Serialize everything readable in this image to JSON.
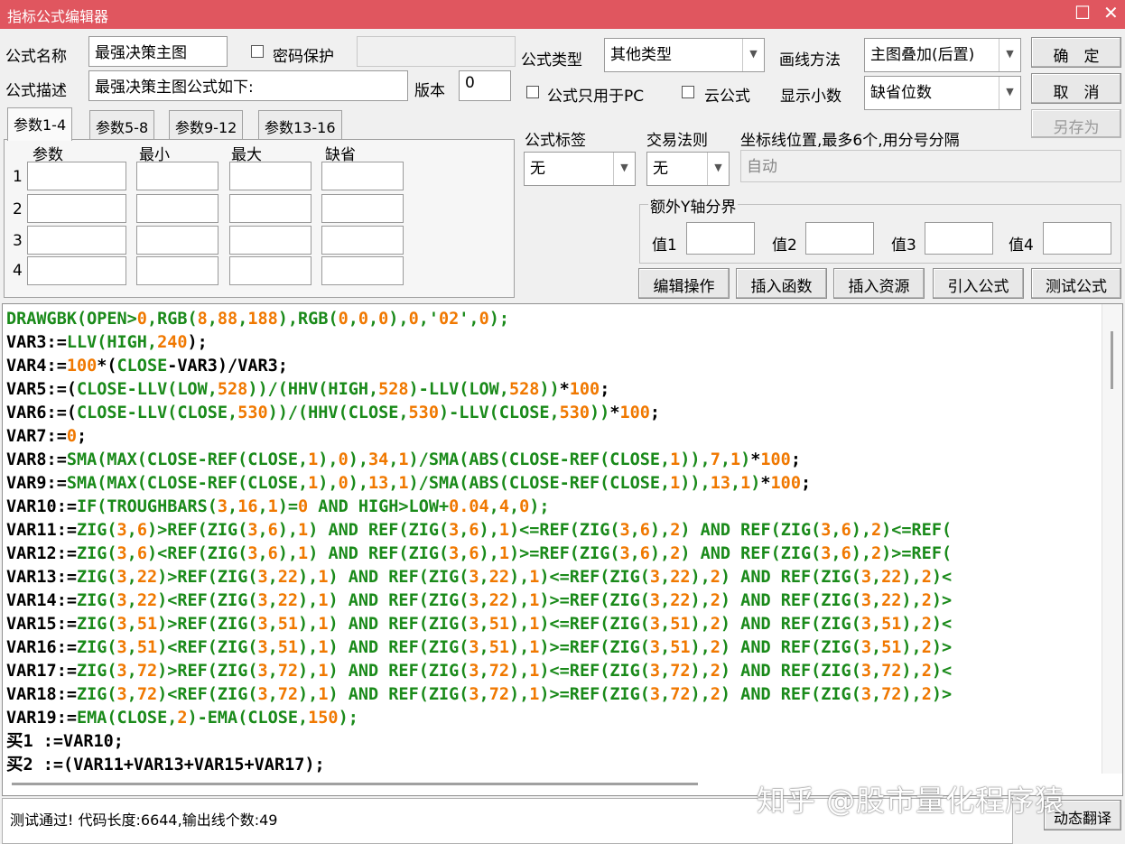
{
  "window": {
    "title": "指标公式编辑器",
    "restore_glyph": "☐",
    "close_glyph": "✕"
  },
  "form": {
    "name_label": "公式名称",
    "name_value": "最强决策主图",
    "password_label": "密码保护",
    "password_value": "",
    "desc_label": "公式描述",
    "desc_value": "最强决策主图公式如下:",
    "version_label": "版本",
    "version_value": "0",
    "type_label": "公式类型",
    "type_value": "其他类型",
    "draw_label": "画线方法",
    "draw_value": "主图叠加(后置)",
    "pc_only_label": "公式只用于PC",
    "cloud_label": "云公式",
    "decimals_label": "显示小数",
    "decimals_value": "缺省位数",
    "tag_label": "公式标签",
    "tag_value": "无",
    "rule_label": "交易法则",
    "rule_value": "无",
    "coord_label": "坐标线位置,最多6个,用分号分隔",
    "coord_placeholder": "自动",
    "yaxis_legend": "额外Y轴分界",
    "yvalues": [
      "值1",
      "值2",
      "值3",
      "值4"
    ]
  },
  "buttons": {
    "ok": "确　定",
    "cancel": "取　消",
    "save_as": "另存为",
    "edit_ops": "编辑操作",
    "insert_func": "插入函数",
    "insert_res": "插入资源",
    "import_formula": "引入公式",
    "test_formula": "测试公式",
    "dynamic_translate": "动态翻译"
  },
  "tabs": [
    "参数1-4",
    "参数5-8",
    "参数9-12",
    "参数13-16"
  ],
  "params": {
    "headers": [
      "参数",
      "最小",
      "最大",
      "缺省"
    ],
    "rows": [
      "1",
      "2",
      "3",
      "4"
    ]
  },
  "colors": {
    "keyword": "#1a8a1a",
    "number": "#f07800",
    "plain": "#000000",
    "title_bar": "#e0565f"
  },
  "code_lines": [
    [
      [
        "g",
        "DRAWGBK(OPEN>"
      ],
      [
        "o",
        "0"
      ],
      [
        "g",
        ",RGB("
      ],
      [
        "o",
        "8"
      ],
      [
        "g",
        ","
      ],
      [
        "o",
        "88"
      ],
      [
        "g",
        ","
      ],
      [
        "o",
        "188"
      ],
      [
        "g",
        "),RGB("
      ],
      [
        "o",
        "0"
      ],
      [
        "g",
        ","
      ],
      [
        "o",
        "0"
      ],
      [
        "g",
        ","
      ],
      [
        "o",
        "0"
      ],
      [
        "g",
        "),"
      ],
      [
        "o",
        "0"
      ],
      [
        "g",
        ",'"
      ],
      [
        "o",
        "02"
      ],
      [
        "g",
        "',"
      ],
      [
        "o",
        "0"
      ],
      [
        "g",
        ");"
      ]
    ],
    [
      [
        "k",
        "VAR3:="
      ],
      [
        "g",
        "LLV(HIGH,"
      ],
      [
        "o",
        "240"
      ],
      [
        "k",
        ");"
      ]
    ],
    [
      [
        "k",
        "VAR4:="
      ],
      [
        "o",
        "100"
      ],
      [
        "k",
        "*("
      ],
      [
        "g",
        "CLOSE"
      ],
      [
        "k",
        "-VAR3)/VAR3;"
      ]
    ],
    [
      [
        "k",
        "VAR5:=("
      ],
      [
        "g",
        "CLOSE-LLV(LOW,"
      ],
      [
        "o",
        "528"
      ],
      [
        "g",
        "))/(HHV(HIGH,"
      ],
      [
        "o",
        "528"
      ],
      [
        "g",
        ")-LLV(LOW,"
      ],
      [
        "o",
        "528"
      ],
      [
        "g",
        "))"
      ],
      [
        "k",
        "*"
      ],
      [
        "o",
        "100"
      ],
      [
        "k",
        ";"
      ]
    ],
    [
      [
        "k",
        "VAR6:=("
      ],
      [
        "g",
        "CLOSE-LLV(CLOSE,"
      ],
      [
        "o",
        "530"
      ],
      [
        "g",
        "))/(HHV(CLOSE,"
      ],
      [
        "o",
        "530"
      ],
      [
        "g",
        ")-LLV(CLOSE,"
      ],
      [
        "o",
        "530"
      ],
      [
        "g",
        "))"
      ],
      [
        "k",
        "*"
      ],
      [
        "o",
        "100"
      ],
      [
        "k",
        ";"
      ]
    ],
    [
      [
        "k",
        "VAR7:="
      ],
      [
        "o",
        "0"
      ],
      [
        "k",
        ";"
      ]
    ],
    [
      [
        "k",
        "VAR8:="
      ],
      [
        "g",
        "SMA(MAX(CLOSE-REF(CLOSE,"
      ],
      [
        "o",
        "1"
      ],
      [
        "g",
        "),"
      ],
      [
        "o",
        "0"
      ],
      [
        "g",
        "),"
      ],
      [
        "o",
        "34"
      ],
      [
        "g",
        ","
      ],
      [
        "o",
        "1"
      ],
      [
        "g",
        ")/SMA(ABS(CLOSE-REF(CLOSE,"
      ],
      [
        "o",
        "1"
      ],
      [
        "g",
        ")),"
      ],
      [
        "o",
        "7"
      ],
      [
        "g",
        ","
      ],
      [
        "o",
        "1"
      ],
      [
        "g",
        ")"
      ],
      [
        "k",
        "*"
      ],
      [
        "o",
        "100"
      ],
      [
        "k",
        ";"
      ]
    ],
    [
      [
        "k",
        "VAR9:="
      ],
      [
        "g",
        "SMA(MAX(CLOSE-REF(CLOSE,"
      ],
      [
        "o",
        "1"
      ],
      [
        "g",
        "),"
      ],
      [
        "o",
        "0"
      ],
      [
        "g",
        "),"
      ],
      [
        "o",
        "13"
      ],
      [
        "g",
        ","
      ],
      [
        "o",
        "1"
      ],
      [
        "g",
        ")/SMA(ABS(CLOSE-REF(CLOSE,"
      ],
      [
        "o",
        "1"
      ],
      [
        "g",
        ")),"
      ],
      [
        "o",
        "13"
      ],
      [
        "g",
        ","
      ],
      [
        "o",
        "1"
      ],
      [
        "g",
        ")"
      ],
      [
        "k",
        "*"
      ],
      [
        "o",
        "100"
      ],
      [
        "k",
        ";"
      ]
    ],
    [
      [
        "k",
        "VAR10:="
      ],
      [
        "g",
        "IF(TROUGHBARS("
      ],
      [
        "o",
        "3"
      ],
      [
        "g",
        ","
      ],
      [
        "o",
        "16"
      ],
      [
        "g",
        ","
      ],
      [
        "o",
        "1"
      ],
      [
        "g",
        ")="
      ],
      [
        "o",
        "0"
      ],
      [
        "g",
        " AND HIGH>LOW+"
      ],
      [
        "o",
        "0.04"
      ],
      [
        "g",
        ","
      ],
      [
        "o",
        "4"
      ],
      [
        "g",
        ","
      ],
      [
        "o",
        "0"
      ],
      [
        "g",
        ");"
      ]
    ],
    [
      [
        "k",
        "VAR11:="
      ],
      [
        "g",
        "ZIG("
      ],
      [
        "o",
        "3"
      ],
      [
        "g",
        ","
      ],
      [
        "o",
        "6"
      ],
      [
        "g",
        ")>REF(ZIG("
      ],
      [
        "o",
        "3"
      ],
      [
        "g",
        ","
      ],
      [
        "o",
        "6"
      ],
      [
        "g",
        "),"
      ],
      [
        "o",
        "1"
      ],
      [
        "g",
        ") AND REF(ZIG("
      ],
      [
        "o",
        "3"
      ],
      [
        "g",
        ","
      ],
      [
        "o",
        "6"
      ],
      [
        "g",
        "),"
      ],
      [
        "o",
        "1"
      ],
      [
        "g",
        ")<=REF(ZIG("
      ],
      [
        "o",
        "3"
      ],
      [
        "g",
        ","
      ],
      [
        "o",
        "6"
      ],
      [
        "g",
        "),"
      ],
      [
        "o",
        "2"
      ],
      [
        "g",
        ") AND REF(ZIG("
      ],
      [
        "o",
        "3"
      ],
      [
        "g",
        ","
      ],
      [
        "o",
        "6"
      ],
      [
        "g",
        "),"
      ],
      [
        "o",
        "2"
      ],
      [
        "g",
        ")<=REF("
      ]
    ],
    [
      [
        "k",
        "VAR12:="
      ],
      [
        "g",
        "ZIG("
      ],
      [
        "o",
        "3"
      ],
      [
        "g",
        ","
      ],
      [
        "o",
        "6"
      ],
      [
        "g",
        ")<REF(ZIG("
      ],
      [
        "o",
        "3"
      ],
      [
        "g",
        ","
      ],
      [
        "o",
        "6"
      ],
      [
        "g",
        "),"
      ],
      [
        "o",
        "1"
      ],
      [
        "g",
        ") AND REF(ZIG("
      ],
      [
        "o",
        "3"
      ],
      [
        "g",
        ","
      ],
      [
        "o",
        "6"
      ],
      [
        "g",
        "),"
      ],
      [
        "o",
        "1"
      ],
      [
        "g",
        ")>=REF(ZIG("
      ],
      [
        "o",
        "3"
      ],
      [
        "g",
        ","
      ],
      [
        "o",
        "6"
      ],
      [
        "g",
        "),"
      ],
      [
        "o",
        "2"
      ],
      [
        "g",
        ") AND REF(ZIG("
      ],
      [
        "o",
        "3"
      ],
      [
        "g",
        ","
      ],
      [
        "o",
        "6"
      ],
      [
        "g",
        "),"
      ],
      [
        "o",
        "2"
      ],
      [
        "g",
        ")>=REF("
      ]
    ],
    [
      [
        "k",
        "VAR13:="
      ],
      [
        "g",
        "ZIG("
      ],
      [
        "o",
        "3"
      ],
      [
        "g",
        ","
      ],
      [
        "o",
        "22"
      ],
      [
        "g",
        ")>REF(ZIG("
      ],
      [
        "o",
        "3"
      ],
      [
        "g",
        ","
      ],
      [
        "o",
        "22"
      ],
      [
        "g",
        "),"
      ],
      [
        "o",
        "1"
      ],
      [
        "g",
        ") AND REF(ZIG("
      ],
      [
        "o",
        "3"
      ],
      [
        "g",
        ","
      ],
      [
        "o",
        "22"
      ],
      [
        "g",
        "),"
      ],
      [
        "o",
        "1"
      ],
      [
        "g",
        ")<=REF(ZIG("
      ],
      [
        "o",
        "3"
      ],
      [
        "g",
        ","
      ],
      [
        "o",
        "22"
      ],
      [
        "g",
        "),"
      ],
      [
        "o",
        "2"
      ],
      [
        "g",
        ") AND REF(ZIG("
      ],
      [
        "o",
        "3"
      ],
      [
        "g",
        ","
      ],
      [
        "o",
        "22"
      ],
      [
        "g",
        "),"
      ],
      [
        "o",
        "2"
      ],
      [
        "g",
        ")<"
      ]
    ],
    [
      [
        "k",
        "VAR14:="
      ],
      [
        "g",
        "ZIG("
      ],
      [
        "o",
        "3"
      ],
      [
        "g",
        ","
      ],
      [
        "o",
        "22"
      ],
      [
        "g",
        ")<REF(ZIG("
      ],
      [
        "o",
        "3"
      ],
      [
        "g",
        ","
      ],
      [
        "o",
        "22"
      ],
      [
        "g",
        "),"
      ],
      [
        "o",
        "1"
      ],
      [
        "g",
        ") AND REF(ZIG("
      ],
      [
        "o",
        "3"
      ],
      [
        "g",
        ","
      ],
      [
        "o",
        "22"
      ],
      [
        "g",
        "),"
      ],
      [
        "o",
        "1"
      ],
      [
        "g",
        ")>=REF(ZIG("
      ],
      [
        "o",
        "3"
      ],
      [
        "g",
        ","
      ],
      [
        "o",
        "22"
      ],
      [
        "g",
        "),"
      ],
      [
        "o",
        "2"
      ],
      [
        "g",
        ") AND REF(ZIG("
      ],
      [
        "o",
        "3"
      ],
      [
        "g",
        ","
      ],
      [
        "o",
        "22"
      ],
      [
        "g",
        "),"
      ],
      [
        "o",
        "2"
      ],
      [
        "g",
        ")>"
      ]
    ],
    [
      [
        "k",
        "VAR15:="
      ],
      [
        "g",
        "ZIG("
      ],
      [
        "o",
        "3"
      ],
      [
        "g",
        ","
      ],
      [
        "o",
        "51"
      ],
      [
        "g",
        ")>REF(ZIG("
      ],
      [
        "o",
        "3"
      ],
      [
        "g",
        ","
      ],
      [
        "o",
        "51"
      ],
      [
        "g",
        "),"
      ],
      [
        "o",
        "1"
      ],
      [
        "g",
        ") AND REF(ZIG("
      ],
      [
        "o",
        "3"
      ],
      [
        "g",
        ","
      ],
      [
        "o",
        "51"
      ],
      [
        "g",
        "),"
      ],
      [
        "o",
        "1"
      ],
      [
        "g",
        ")<=REF(ZIG("
      ],
      [
        "o",
        "3"
      ],
      [
        "g",
        ","
      ],
      [
        "o",
        "51"
      ],
      [
        "g",
        "),"
      ],
      [
        "o",
        "2"
      ],
      [
        "g",
        ") AND REF(ZIG("
      ],
      [
        "o",
        "3"
      ],
      [
        "g",
        ","
      ],
      [
        "o",
        "51"
      ],
      [
        "g",
        "),"
      ],
      [
        "o",
        "2"
      ],
      [
        "g",
        ")<"
      ]
    ],
    [
      [
        "k",
        "VAR16:="
      ],
      [
        "g",
        "ZIG("
      ],
      [
        "o",
        "3"
      ],
      [
        "g",
        ","
      ],
      [
        "o",
        "51"
      ],
      [
        "g",
        ")<REF(ZIG("
      ],
      [
        "o",
        "3"
      ],
      [
        "g",
        ","
      ],
      [
        "o",
        "51"
      ],
      [
        "g",
        "),"
      ],
      [
        "o",
        "1"
      ],
      [
        "g",
        ") AND REF(ZIG("
      ],
      [
        "o",
        "3"
      ],
      [
        "g",
        ","
      ],
      [
        "o",
        "51"
      ],
      [
        "g",
        "),"
      ],
      [
        "o",
        "1"
      ],
      [
        "g",
        ")>=REF(ZIG("
      ],
      [
        "o",
        "3"
      ],
      [
        "g",
        ","
      ],
      [
        "o",
        "51"
      ],
      [
        "g",
        "),"
      ],
      [
        "o",
        "2"
      ],
      [
        "g",
        ") AND REF(ZIG("
      ],
      [
        "o",
        "3"
      ],
      [
        "g",
        ","
      ],
      [
        "o",
        "51"
      ],
      [
        "g",
        "),"
      ],
      [
        "o",
        "2"
      ],
      [
        "g",
        ")>"
      ]
    ],
    [
      [
        "k",
        "VAR17:="
      ],
      [
        "g",
        "ZIG("
      ],
      [
        "o",
        "3"
      ],
      [
        "g",
        ","
      ],
      [
        "o",
        "72"
      ],
      [
        "g",
        ")>REF(ZIG("
      ],
      [
        "o",
        "3"
      ],
      [
        "g",
        ","
      ],
      [
        "o",
        "72"
      ],
      [
        "g",
        "),"
      ],
      [
        "o",
        "1"
      ],
      [
        "g",
        ") AND REF(ZIG("
      ],
      [
        "o",
        "3"
      ],
      [
        "g",
        ","
      ],
      [
        "o",
        "72"
      ],
      [
        "g",
        "),"
      ],
      [
        "o",
        "1"
      ],
      [
        "g",
        ")<=REF(ZIG("
      ],
      [
        "o",
        "3"
      ],
      [
        "g",
        ","
      ],
      [
        "o",
        "72"
      ],
      [
        "g",
        "),"
      ],
      [
        "o",
        "2"
      ],
      [
        "g",
        ") AND REF(ZIG("
      ],
      [
        "o",
        "3"
      ],
      [
        "g",
        ","
      ],
      [
        "o",
        "72"
      ],
      [
        "g",
        "),"
      ],
      [
        "o",
        "2"
      ],
      [
        "g",
        ")<"
      ]
    ],
    [
      [
        "k",
        "VAR18:="
      ],
      [
        "g",
        "ZIG("
      ],
      [
        "o",
        "3"
      ],
      [
        "g",
        ","
      ],
      [
        "o",
        "72"
      ],
      [
        "g",
        ")<REF(ZIG("
      ],
      [
        "o",
        "3"
      ],
      [
        "g",
        ","
      ],
      [
        "o",
        "72"
      ],
      [
        "g",
        "),"
      ],
      [
        "o",
        "1"
      ],
      [
        "g",
        ") AND REF(ZIG("
      ],
      [
        "o",
        "3"
      ],
      [
        "g",
        ","
      ],
      [
        "o",
        "72"
      ],
      [
        "g",
        "),"
      ],
      [
        "o",
        "1"
      ],
      [
        "g",
        ")>=REF(ZIG("
      ],
      [
        "o",
        "3"
      ],
      [
        "g",
        ","
      ],
      [
        "o",
        "72"
      ],
      [
        "g",
        "),"
      ],
      [
        "o",
        "2"
      ],
      [
        "g",
        ") AND REF(ZIG("
      ],
      [
        "o",
        "3"
      ],
      [
        "g",
        ","
      ],
      [
        "o",
        "72"
      ],
      [
        "g",
        "),"
      ],
      [
        "o",
        "2"
      ],
      [
        "g",
        ")>"
      ]
    ],
    [
      [
        "k",
        "VAR19:="
      ],
      [
        "g",
        "EMA(CLOSE,"
      ],
      [
        "o",
        "2"
      ],
      [
        "g",
        ")-EMA(CLOSE,"
      ],
      [
        "o",
        "150"
      ],
      [
        "g",
        ");"
      ]
    ],
    [
      [
        "k",
        "买1 :=VAR10;"
      ]
    ],
    [
      [
        "k",
        "买2 :=(VAR11+VAR13+VAR15+VAR17);"
      ]
    ]
  ],
  "status_text": "测试通过! 代码长度:6644,输出线个数:49",
  "watermark": "知乎 @股市量化程序猿"
}
